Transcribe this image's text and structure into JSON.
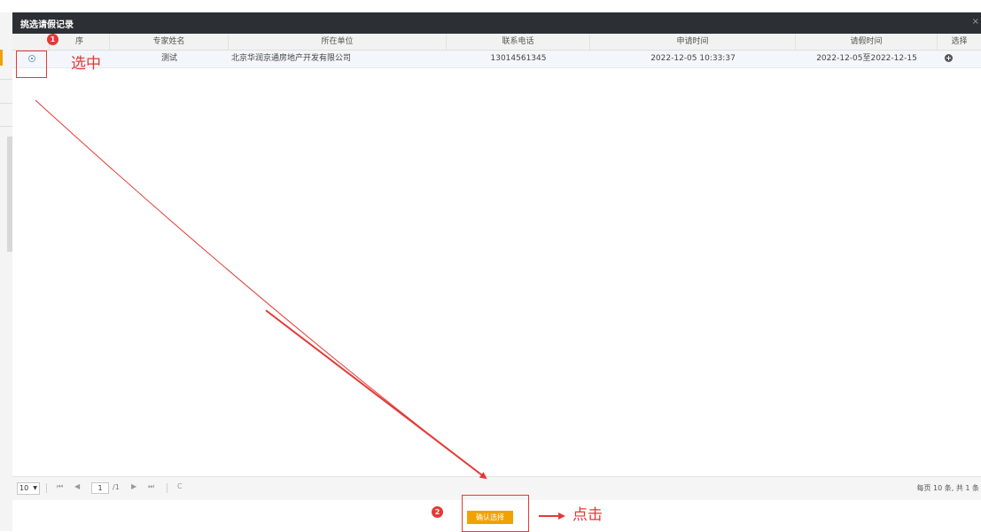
{
  "dialog": {
    "title": "挑选请假记录",
    "close_glyph": "×"
  },
  "table": {
    "columns": [
      "序",
      "专家姓名",
      "所在单位",
      "联系电话",
      "申请时间",
      "请假时间",
      "选择"
    ],
    "rows": [
      {
        "selected": true,
        "name": "测试",
        "unit": "北京华润京通房地产开发有限公司",
        "phone": "13014561345",
        "apply_time": "2022-12-05 10:33:37",
        "leave_period": "2022-12-05至2022-12-15",
        "action_icon": "plus-circle-icon"
      }
    ]
  },
  "pager": {
    "page_size": "10",
    "current_page": "1",
    "total_pages": "/1",
    "info": "每页 10 条, 共 1 条",
    "first_glyph": "⏮",
    "prev_glyph": "◀",
    "next_glyph": "▶",
    "last_glyph": "⏭",
    "refresh_glyph": "C"
  },
  "footer": {
    "confirm_label": "确认选择"
  },
  "annotations": {
    "step1_badge": "1",
    "step1_text": "选中",
    "step2_badge": "2",
    "step2_text": "点击",
    "color": "#e53935"
  },
  "colors": {
    "titlebar": "#2c2f33",
    "accent_button": "#f0a202",
    "selected_row": "#f3f6fa"
  }
}
